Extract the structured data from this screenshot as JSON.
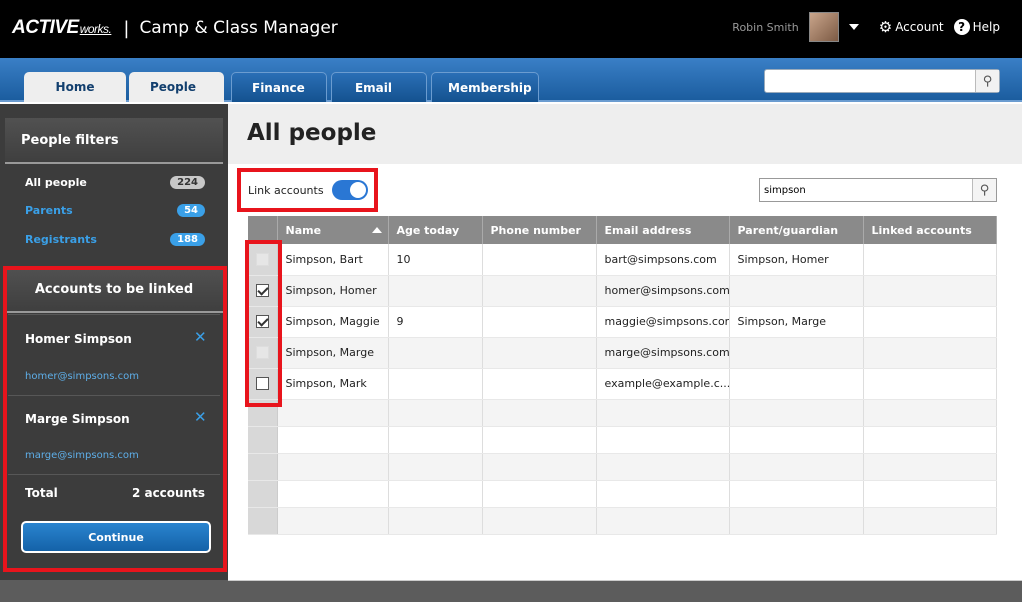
{
  "header": {
    "logo_main": "ACTIVE",
    "logo_sub": "works.",
    "separator": "|",
    "product": "Camp & Class Manager",
    "username": "Robin Smith",
    "account_label": "Account",
    "help_label": "Help"
  },
  "nav": {
    "tabs": [
      "Home",
      "People",
      "Finance",
      "Email",
      "Membership"
    ],
    "active_tab": "People",
    "search_placeholder": ""
  },
  "sidebar": {
    "filters_title": "People filters",
    "filters": [
      {
        "label": "All people",
        "count": "224"
      },
      {
        "label": "Parents",
        "count": "54"
      },
      {
        "label": "Registrants",
        "count": "188"
      }
    ],
    "linked_title": "Accounts to be linked",
    "linked": [
      {
        "name": "Homer Simpson",
        "email": "homer@simpsons.com"
      },
      {
        "name": "Marge Simpson",
        "email": "marge@simpsons.com"
      }
    ],
    "total_label": "Total",
    "total_value": "2 accounts",
    "continue_label": "Continue"
  },
  "main": {
    "title": "All people",
    "link_accounts_label": "Link accounts",
    "search_value": "simpson",
    "columns": [
      "Name",
      "Age today",
      "Phone number",
      "Email address",
      "Parent/guardian",
      "Linked accounts"
    ],
    "rows": [
      {
        "checked": "disabled",
        "name": "Simpson, Bart",
        "age": "10",
        "phone": "",
        "email": "bart@simpsons.com",
        "parent": "Simpson, Homer",
        "linked": ""
      },
      {
        "checked": "on",
        "name": "Simpson, Homer",
        "age": "",
        "phone": "",
        "email": "homer@simpsons.com",
        "parent": "",
        "linked": ""
      },
      {
        "checked": "on",
        "name": "Simpson, Maggie",
        "age": "9",
        "phone": "",
        "email": "maggie@simpsons.com",
        "parent": "Simpson, Marge",
        "linked": ""
      },
      {
        "checked": "disabled",
        "name": "Simpson, Marge",
        "age": "",
        "phone": "",
        "email": "marge@simpsons.com",
        "parent": "",
        "linked": ""
      },
      {
        "checked": "off",
        "name": "Simpson, Mark",
        "age": "",
        "phone": "",
        "email": "example@example.c...",
        "parent": "",
        "linked": ""
      }
    ]
  },
  "colors": {
    "nav_blue": "#1b5d9f",
    "link_blue": "#1a6fc0",
    "highlight_red": "#e8141c",
    "sidebar_bg": "#3c3c3c"
  }
}
